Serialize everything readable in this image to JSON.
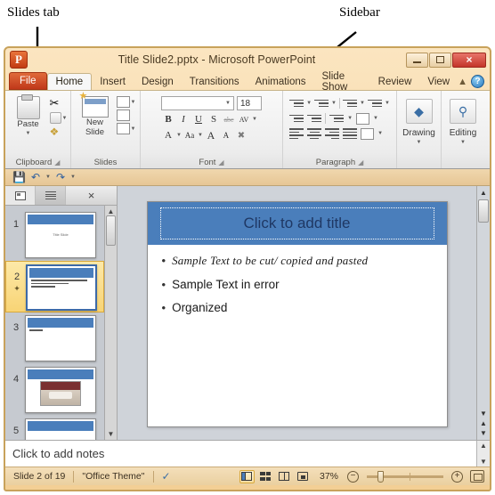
{
  "annotations": [
    {
      "label": "Slides tab",
      "target": "slides-tab"
    },
    {
      "label": "Sidebar",
      "target": "sidebar"
    }
  ],
  "window": {
    "title": "Title Slide2.pptx  -  Microsoft PowerPoint",
    "logo_letter": "P",
    "controls": [
      {
        "name": "minimize-button",
        "label": "minimize-icon"
      },
      {
        "name": "maximize-button",
        "label": "maximize-icon"
      },
      {
        "name": "close-button",
        "label": "×"
      }
    ]
  },
  "ribbon": {
    "tabs": [
      {
        "label": "File",
        "type": "file"
      },
      {
        "label": "Home",
        "type": "active"
      },
      {
        "label": "Insert",
        "type": "normal"
      },
      {
        "label": "Design",
        "type": "normal"
      },
      {
        "label": "Transitions",
        "type": "normal"
      },
      {
        "label": "Animations",
        "type": "normal"
      },
      {
        "label": "Slide Show",
        "type": "normal"
      },
      {
        "label": "Review",
        "type": "normal"
      },
      {
        "label": "View",
        "type": "normal"
      }
    ],
    "minimize_ribbon_icon": "chevron-up-icon",
    "help_icon": "?",
    "groups": {
      "clipboard": {
        "label": "Clipboard",
        "paste_label": "Paste",
        "buttons": [
          "paste-icon",
          "cut-icon",
          "copy-icon",
          "format-painter-icon"
        ]
      },
      "slides": {
        "label": "Slides",
        "new_slide_label": "New\nSlide",
        "new_slide_line1": "New",
        "new_slide_line2": "Slide",
        "buttons": [
          "layout-icon",
          "reset-icon",
          "section-icon"
        ]
      },
      "font": {
        "label": "Font",
        "font_name_value": "",
        "font_size_value": "18",
        "buttons": [
          "bold-icon",
          "italic-icon",
          "underline-icon",
          "shadow-icon",
          "strikethrough-icon",
          "character-spacing-icon",
          "font-color-icon",
          "change-case-icon",
          "grow-font-icon",
          "shrink-font-icon",
          "clear-formatting-icon"
        ],
        "bold": "B",
        "italic": "I",
        "underline": "U",
        "shadow": "S",
        "strike": "abc",
        "spacing": "AV",
        "color": "A",
        "case": "Aa",
        "grow": "A",
        "shrink": "A"
      },
      "paragraph": {
        "label": "Paragraph",
        "buttons": [
          "bullets-icon",
          "numbering-icon",
          "line-spacing-icon",
          "text-direction-icon",
          "decrease-indent-icon",
          "increase-indent-icon",
          "columns-icon",
          "align-text-icon",
          "align-left-icon",
          "align-center-icon",
          "align-right-icon",
          "justify-icon",
          "convert-to-smartart-icon"
        ]
      },
      "drawing": {
        "label": "Drawing",
        "icon": "shapes-icon"
      },
      "editing": {
        "label": "Editing",
        "icon": "binoculars-icon"
      }
    }
  },
  "quick_access_toolbar": {
    "items": [
      {
        "name": "save-button",
        "icon": "save-icon"
      },
      {
        "name": "undo-button",
        "icon": "undo-icon"
      },
      {
        "name": "redo-button",
        "icon": "redo-icon"
      },
      {
        "name": "customize-qat-button",
        "icon": "chevron-down-icon"
      }
    ]
  },
  "left_pane": {
    "tabs": [
      {
        "name": "slides-tab",
        "icon": "slides-thumbnail-icon",
        "active": true
      },
      {
        "name": "outline-tab",
        "icon": "outline-lines-icon",
        "active": false
      }
    ],
    "close_label": "×",
    "thumbnails": [
      {
        "number": "1",
        "selected": false,
        "kind": "title",
        "center_text": "Title Slide",
        "has_animation": false
      },
      {
        "number": "2",
        "selected": true,
        "kind": "bullets",
        "lines": 3,
        "has_animation": true
      },
      {
        "number": "3",
        "selected": false,
        "kind": "bullets",
        "lines": 1,
        "has_animation": false
      },
      {
        "number": "4",
        "selected": false,
        "kind": "image",
        "has_animation": false
      },
      {
        "number": "5",
        "selected": false,
        "kind": "partial",
        "has_animation": false
      }
    ],
    "scroll_up_icon": "▲",
    "scroll_down_icon": "▼"
  },
  "slide": {
    "title_placeholder": "Click to add title",
    "bullets": [
      {
        "text": "Sample Text to be cut/ copied and pasted",
        "style": "script"
      },
      {
        "text": "Sample Text in error",
        "style": "plain"
      },
      {
        "text": "Organized",
        "style": "plain"
      }
    ],
    "bullet_glyph": "•",
    "title_band_color": "#4a7ebb",
    "title_text_color": "#1f3864"
  },
  "notes": {
    "placeholder": "Click to add notes"
  },
  "stage_scrollbar": {
    "up_icon": "▲",
    "down_icon": "▼",
    "previous_slide_icon": "▲",
    "next_slide_icon": "▼"
  },
  "status_bar": {
    "slide_indicator": "Slide 2 of 19",
    "theme": "\"Office Theme\"",
    "spellcheck_icon": "spellcheck-icon",
    "views": [
      {
        "name": "view-normal",
        "label": "Normal",
        "active": true
      },
      {
        "name": "view-slide-sorter",
        "label": "Slide Sorter",
        "active": false
      },
      {
        "name": "view-reading",
        "label": "Reading View",
        "active": false
      },
      {
        "name": "view-slide-show",
        "label": "Slide Show",
        "active": false
      }
    ],
    "zoom_level": "37%",
    "zoom_out_label": "−",
    "zoom_in_label": "+",
    "fit_to_window_icon": "fit-slide-icon"
  },
  "colors": {
    "accent_blue": "#4a7ebb",
    "chrome_amber": "#f3cf95",
    "selection_gold": "#f8d475",
    "file_tab_red": "#c0381a"
  }
}
